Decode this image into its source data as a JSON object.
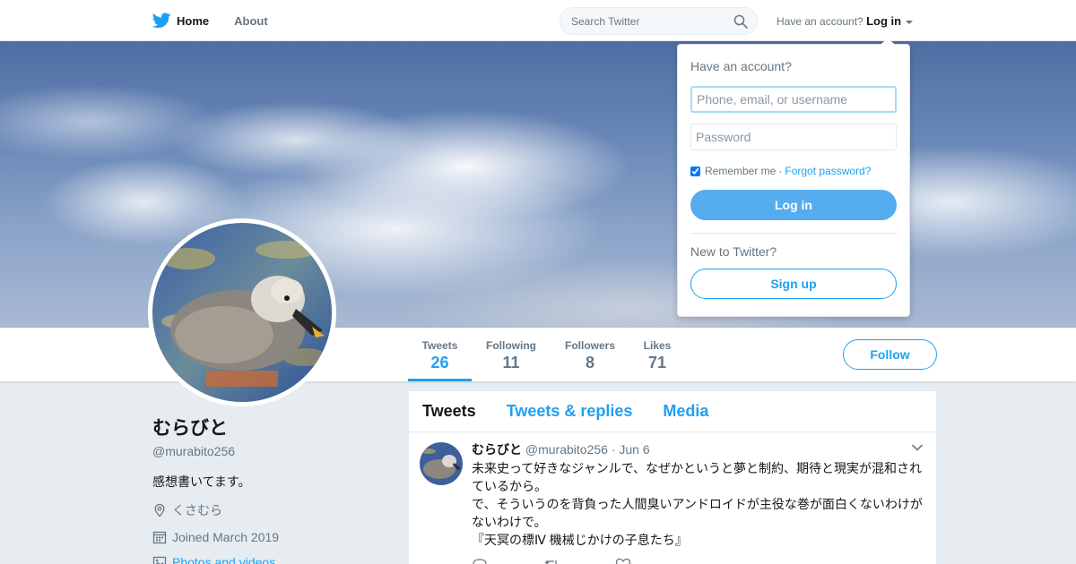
{
  "nav": {
    "home_label": "Home",
    "about_label": "About",
    "search_placeholder": "Search Twitter",
    "account_prompt": "Have an account?",
    "login_label": "Log in"
  },
  "login_dropdown": {
    "title": "Have an account?",
    "username_placeholder": "Phone, email, or username",
    "password_placeholder": "Password",
    "remember_label": "Remember me",
    "separator": "·",
    "forgot_label": "Forgot password?",
    "login_button": "Log in",
    "new_prompt": "New to Twitter?",
    "signup_button": "Sign up"
  },
  "stats": [
    {
      "label": "Tweets",
      "value": "26"
    },
    {
      "label": "Following",
      "value": "11"
    },
    {
      "label": "Followers",
      "value": "8"
    },
    {
      "label": "Likes",
      "value": "71"
    }
  ],
  "follow_label": "Follow",
  "profile": {
    "name": "むらびと",
    "handle": "@murabito256",
    "bio": "感想書いてます。",
    "location": "くさむら",
    "joined": "Joined March 2019",
    "photos_link": "Photos and videos"
  },
  "tabs": [
    "Tweets",
    "Tweets & replies",
    "Media"
  ],
  "tweet": {
    "name": "むらびと",
    "handle": "@murabito256",
    "date": "· Jun 6",
    "lines": [
      "未来史って好きなジャンルで、なぜかというと夢と制約、期待と現実が混和されているから。",
      "で、そういうのを背負った人間臭いアンドロイドが主役な巻が面白くないわけがないわけで。",
      "『天冥の標Ⅳ 機械じかけの子息たち』"
    ]
  },
  "colors": {
    "accent": "#1da1f2",
    "login_button_bg": "#55acee",
    "page_bg": "#e6ecf0"
  }
}
